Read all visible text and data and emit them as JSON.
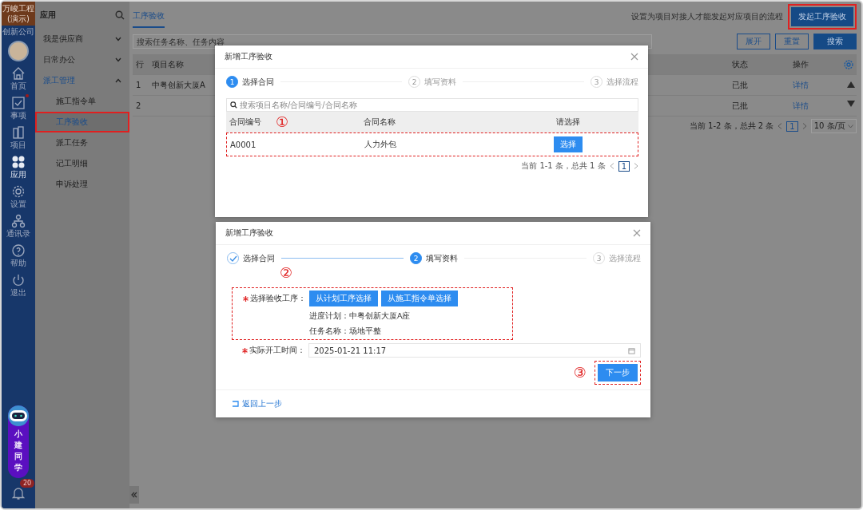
{
  "rail": {
    "brand": "万峻工程",
    "brand_sub": "(演示)",
    "company": "创新公司",
    "items": [
      {
        "label": "首页",
        "kind": "home",
        "selected": false,
        "dot": false
      },
      {
        "label": "事项",
        "kind": "check",
        "selected": false,
        "dot": true
      },
      {
        "label": "项目",
        "kind": "building",
        "selected": false,
        "dot": false
      },
      {
        "label": "应用",
        "kind": "apps",
        "selected": true,
        "dot": false
      },
      {
        "label": "设置",
        "kind": "gear",
        "selected": false,
        "dot": false
      },
      {
        "label": "通讯录",
        "kind": "org",
        "selected": false,
        "dot": false
      },
      {
        "label": "帮助",
        "kind": "help",
        "selected": false,
        "dot": false
      },
      {
        "label": "退出",
        "kind": "power",
        "selected": false,
        "dot": false
      }
    ],
    "assistant": "小建同学",
    "bell_count": "20"
  },
  "sidebar": {
    "title": "应用",
    "groups": [
      {
        "label": "我是供应商",
        "expanded": false
      },
      {
        "label": "日常办公",
        "expanded": false
      },
      {
        "label": "派工管理",
        "expanded": true,
        "children": [
          {
            "label": "施工指令单",
            "selected": false,
            "highlighted": false
          },
          {
            "label": "工序验收",
            "selected": true,
            "highlighted": true
          },
          {
            "label": "派工任务",
            "selected": false,
            "highlighted": false
          },
          {
            "label": "记工明细",
            "selected": false,
            "highlighted": false
          },
          {
            "label": "申诉处理",
            "selected": false,
            "highlighted": false
          }
        ]
      }
    ]
  },
  "main": {
    "tabs": [
      {
        "label": "工序验收",
        "selected": true
      }
    ],
    "notice": "设置为项目对接人才能发起对应项目的流程",
    "primary_button": {
      "label": "发起工序验收",
      "highlighted": true
    },
    "search": {
      "placeholder": "搜索任务名称、任务内容"
    },
    "buttons": [
      {
        "label": "展开",
        "kind": "outline"
      },
      {
        "label": "重置",
        "kind": "outline"
      },
      {
        "label": "搜索",
        "kind": "primary"
      }
    ],
    "table": {
      "columns": [
        "行",
        "项目名称",
        "状态",
        "操作"
      ],
      "rows": [
        {
          "row": "1",
          "project": "中粤创新大厦A",
          "status": "已批",
          "action": "详情"
        },
        {
          "row": "2",
          "status": "已批",
          "action": "详情"
        }
      ]
    },
    "pagination": {
      "summary": "当前 1-2 条，总共 2 条",
      "page": "1",
      "page_size": "10 条/页"
    }
  },
  "dialogs": [
    {
      "title": "新增工序验收",
      "kind": "contract",
      "steps": [
        {
          "num": "1",
          "label": "选择合同",
          "active": true,
          "done": false
        },
        {
          "num": "2",
          "label": "填写资料",
          "active": false,
          "done": false
        },
        {
          "num": "3",
          "label": "选择流程",
          "active": false,
          "done": false
        }
      ],
      "search": {
        "placeholder": "搜索项目名称/合同编号/合同名称"
      },
      "columns": [
        "合同编号",
        "合同名称",
        "请选择"
      ],
      "rows": [
        {
          "code": "A0001",
          "name": "人力外包",
          "button": "选择",
          "highlighted": true
        }
      ],
      "marker": "①",
      "pagination": {
        "summary": "当前 1-1 条，总共 1 条",
        "page": "1"
      }
    },
    {
      "title": "新增工序验收",
      "kind": "form",
      "steps": [
        {
          "label": "选择合同",
          "active": false,
          "done": true
        },
        {
          "num": "2",
          "label": "填写资料",
          "active": true,
          "done": false
        },
        {
          "num": "3",
          "label": "选择流程",
          "active": false,
          "done": false
        }
      ],
      "pick": {
        "label": "选择验收工序：",
        "required": true,
        "buttons": [
          "从计划工序选择",
          "从施工指令单选择"
        ],
        "info": [
          {
            "label": "进度计划：",
            "value": "中粤创新大厦A座"
          },
          {
            "label": "任务名称：",
            "value": "场地平整"
          }
        ],
        "highlighted": true,
        "marker": "②"
      },
      "time": {
        "label": "实际开工时间：",
        "required": true,
        "value": "2025-01-21 11:17"
      },
      "next": {
        "label": "下一步",
        "highlighted": true,
        "marker": "③"
      },
      "back": "返回上一步"
    }
  ]
}
